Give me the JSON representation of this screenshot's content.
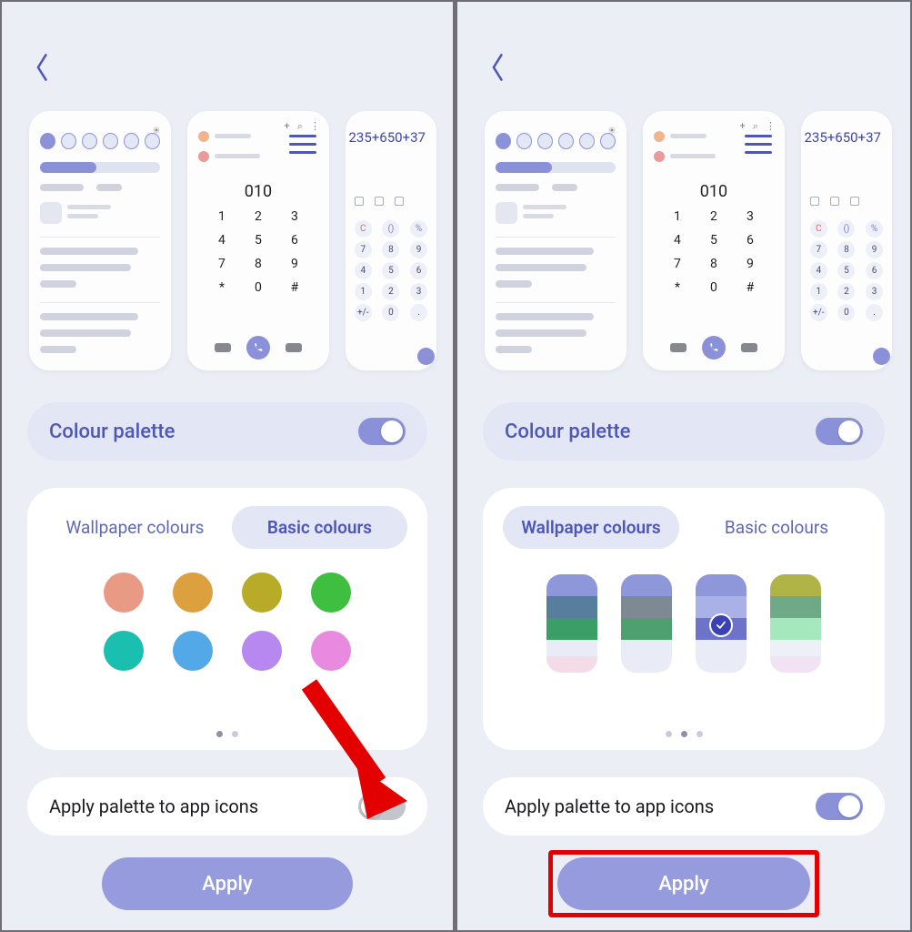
{
  "left": {
    "palette_title": "Colour palette",
    "tabs": {
      "wallpaper": "Wallpaper colours",
      "basic": "Basic colours",
      "active": "basic"
    },
    "basic_colors": [
      "#e99a85",
      "#dca03e",
      "#b7ab27",
      "#3fbf3f",
      "#1bbfaf",
      "#53a9e8",
      "#b788f0",
      "#e88adf"
    ],
    "apply_icons_label": "Apply palette to app icons",
    "apply_icons_on": false,
    "apply_label": "Apply",
    "preview_dialer": {
      "display": "010",
      "pad": [
        [
          "1",
          "2",
          "3"
        ],
        [
          "4",
          "5",
          "6"
        ],
        [
          "7",
          "8",
          "9"
        ],
        [
          "*",
          "0",
          "#"
        ]
      ]
    },
    "preview_calc": {
      "expr": "235+650+37",
      "rows": [
        [
          "C",
          "()",
          "%"
        ],
        [
          "7",
          "8",
          "9"
        ],
        [
          "4",
          "5",
          "6"
        ],
        [
          "1",
          "2",
          "3"
        ],
        [
          "+/-",
          "0",
          "."
        ]
      ]
    }
  },
  "right": {
    "palette_title": "Colour palette",
    "tabs": {
      "wallpaper": "Wallpaper colours",
      "basic": "Basic colours",
      "active": "wallpaper"
    },
    "wallpaper_palettes": [
      {
        "colors": [
          "#8f97db",
          "#587e9e",
          "#3c9e67",
          "#e9ecf7",
          "#f3dbe7"
        ],
        "selected": false
      },
      {
        "colors": [
          "#8f97db",
          "#7d8a93",
          "#4ea06e",
          "#e9ecf7",
          "#e9ecf7"
        ],
        "selected": false
      },
      {
        "colors": [
          "#8f97db",
          "#a9b1e6",
          "#6c73c8",
          "#e9ecf7",
          "#e9ecf7"
        ],
        "selected": true
      },
      {
        "colors": [
          "#b0b346",
          "#6fa987",
          "#a5e8be",
          "#eef0f8",
          "#f2e3f4"
        ],
        "selected": false
      }
    ],
    "apply_icons_label": "Apply palette to app icons",
    "apply_icons_on": true,
    "apply_label": "Apply",
    "preview_dialer": {
      "display": "010",
      "pad": [
        [
          "1",
          "2",
          "3"
        ],
        [
          "4",
          "5",
          "6"
        ],
        [
          "7",
          "8",
          "9"
        ],
        [
          "*",
          "0",
          "#"
        ]
      ]
    },
    "preview_calc": {
      "expr": "235+650+37",
      "rows": [
        [
          "C",
          "()",
          "%"
        ],
        [
          "7",
          "8",
          "9"
        ],
        [
          "4",
          "5",
          "6"
        ],
        [
          "1",
          "2",
          "3"
        ],
        [
          "+/-",
          "0",
          "."
        ]
      ]
    }
  }
}
